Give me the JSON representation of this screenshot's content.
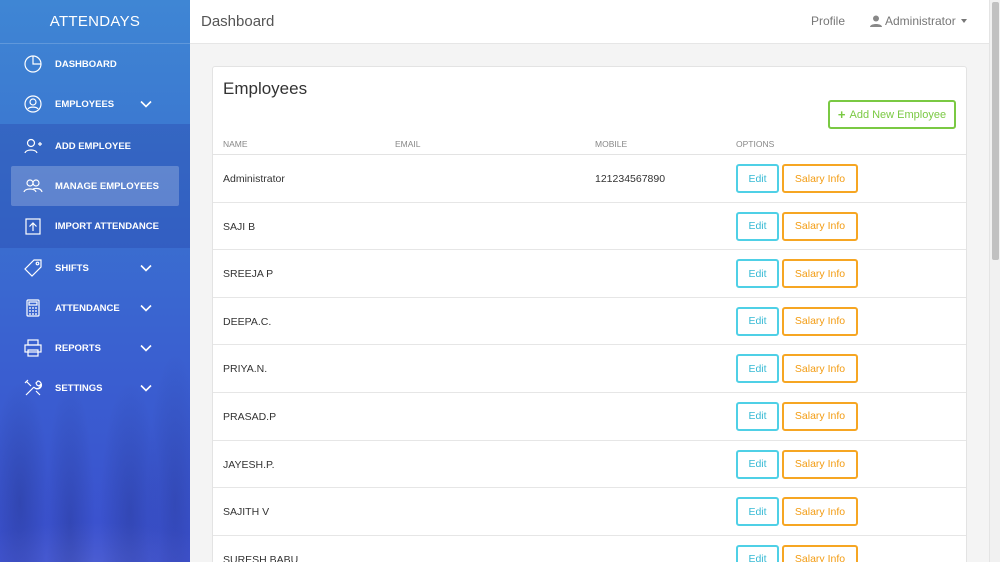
{
  "sidebar": {
    "brand": "ATTENDAYS",
    "items": [
      {
        "label": "DASHBOARD",
        "icon": "pie-chart-icon"
      },
      {
        "label": "EMPLOYEES",
        "icon": "user-icon"
      },
      {
        "label": "SHIFTS",
        "icon": "tag-icon"
      },
      {
        "label": "ATTENDANCE",
        "icon": "calculator-icon"
      },
      {
        "label": "REPORTS",
        "icon": "printer-icon"
      },
      {
        "label": "SETTINGS",
        "icon": "tools-icon"
      }
    ],
    "submenu": [
      {
        "label": "ADD EMPLOYEE",
        "icon": "user-plus-icon"
      },
      {
        "label": "MANAGE EMPLOYEES",
        "icon": "users-icon",
        "active": true
      },
      {
        "label": "IMPORT ATTENDANCE",
        "icon": "upload-icon"
      }
    ]
  },
  "topbar": {
    "title": "Dashboard",
    "profile": "Profile",
    "user": "Administrator"
  },
  "card": {
    "title": "Employees",
    "add_button": "Add New Employee",
    "columns": [
      "NAME",
      "EMAIL",
      "MOBILE",
      "OPTIONS"
    ],
    "edit_label": "Edit",
    "salary_label": "Salary Info",
    "rows": [
      {
        "name": "Administrator",
        "email": "",
        "mobile": "121234567890"
      },
      {
        "name": "SAJI B",
        "email": "",
        "mobile": ""
      },
      {
        "name": "SREEJA P",
        "email": "",
        "mobile": ""
      },
      {
        "name": "DEEPA.C.",
        "email": "",
        "mobile": ""
      },
      {
        "name": "PRIYA.N.",
        "email": "",
        "mobile": ""
      },
      {
        "name": "PRASAD.P",
        "email": "",
        "mobile": ""
      },
      {
        "name": "JAYESH.P.",
        "email": "",
        "mobile": ""
      },
      {
        "name": "SAJITH V",
        "email": "",
        "mobile": ""
      },
      {
        "name": "SURESH BABU",
        "email": "",
        "mobile": ""
      }
    ]
  },
  "colors": {
    "accent_green": "#7ac943",
    "edit_cyan": "#4fd0e6",
    "salary_orange": "#f6a623",
    "sidebar_top": "#3f86d4",
    "sidebar_bottom": "#3b4fce"
  }
}
